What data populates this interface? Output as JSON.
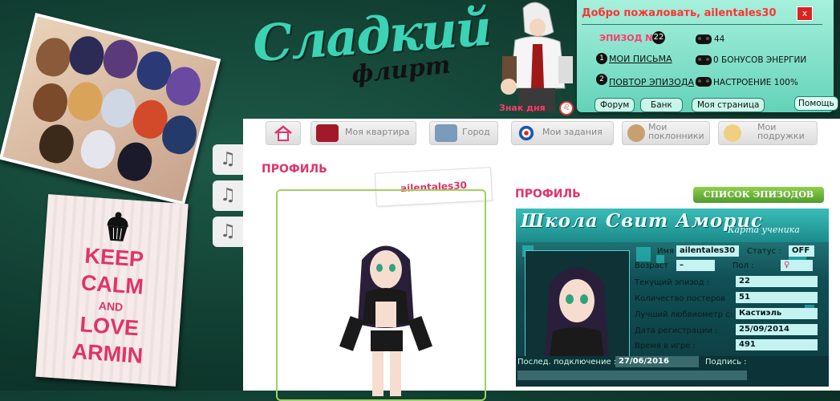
{
  "logo": {
    "main": "Сладкий",
    "sub": "флирт"
  },
  "header": {
    "sign_label": "Знак дня"
  },
  "welcome": {
    "title": "Добро пожаловать, ailentales30",
    "close_label": "x",
    "episode_label": "ЭПИЗОД №",
    "episode_number": "22",
    "messages_num": "1",
    "messages_link": "МОИ ПИСЬМА",
    "replay_num": "2",
    "replay_link": "ПОВТОР ЭПИЗОДА",
    "pa": "44",
    "energy_bonus": "0 БОНУСОВ ЭНЕРГИИ",
    "mood": "НАСТРОЕНИЕ 100%",
    "buttons": {
      "forum": "Форум",
      "bank": "Банк",
      "my_page": "Моя страница",
      "help": "Помощь"
    }
  },
  "decor": {
    "keep_calm": [
      "KEEP",
      "CALM",
      "AND",
      "LOVE",
      "ARMIN"
    ],
    "music_icon": "♫"
  },
  "nav": {
    "home_icon": "home-icon",
    "items": [
      {
        "label": "Моя квартира",
        "icon": "sofa-icon"
      },
      {
        "label": "Город",
        "icon": "building-icon"
      },
      {
        "label": "Мои задания",
        "icon": "target-icon"
      },
      {
        "label": "Мои поклонники",
        "icon": "boy-icon"
      },
      {
        "label": "Мои подружки",
        "icon": "girl-icon"
      }
    ]
  },
  "profile": {
    "title": "ПРОФИЛЬ",
    "username": "ailentales30",
    "right_title": "ПРОФИЛЬ",
    "episodes_button": "СПИСОК ЭПИЗОДОВ"
  },
  "card": {
    "title": "Школа Свит Аморис",
    "subtitle": "Карта ученика",
    "name_label": "Имя",
    "name": "ailentales30",
    "status_label": "Статус :",
    "status": "OFF",
    "age_label": "Возраст",
    "age": "–",
    "gender_label": "Пол :",
    "gender": "♀",
    "episode_label": "Текущий эпизод :",
    "episode": "22",
    "posters_label": "Количество постеров",
    "posters": "51",
    "love_label": "Лучший любвиометр с:",
    "love": "Кастиэль",
    "reg_label": "Дата регистрации :",
    "reg": "25/09/2014",
    "time_label": "Время в игре :",
    "time": "491",
    "last_label": "Послед. подключение :",
    "last": "27/06/2016",
    "sign_label": "Подпись :"
  },
  "colors": {
    "accent": "#e0336a",
    "teal": "#3cd2b4",
    "green_btn": "#6bb63a"
  }
}
